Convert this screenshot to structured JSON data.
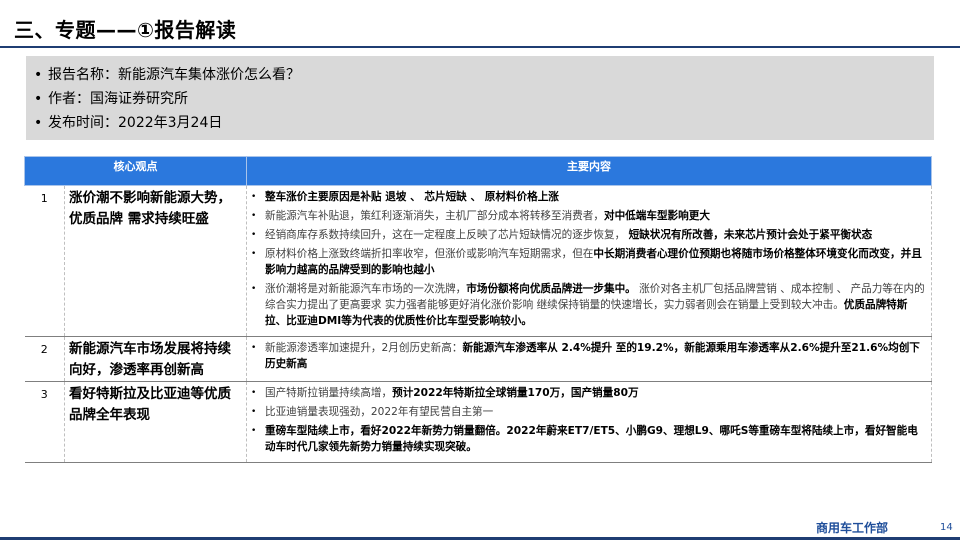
{
  "header": {
    "title": "三、专题——①报告解读"
  },
  "info": [
    "报告名称：新能源汽车集体涨价怎么看？",
    "作者：国海证券研究所",
    "发布时间：2022年3月24日"
  ],
  "table": {
    "headers": [
      "核心观点",
      "主要内容"
    ],
    "rows": [
      {
        "num": "1",
        "point": "涨价潮不影响新能源大势，优质品牌 需求持续旺盛",
        "bullets": [
          {
            "plain": "",
            "bold": "整车涨价主要原因是补贴 退坡 、 芯片短缺 、 原材料价格上涨",
            "tail": ""
          },
          {
            "plain": "新能源汽车补贴退，策红利逐渐消失，主机厂部分成本将转移至消费者，",
            "bold": "对中低端车型影响更大",
            "tail": ""
          },
          {
            "plain": "经销商库存系数持续回升，这在一定程度上反映了芯片短缺情况的逐步恢复， ",
            "bold": "短缺状况有所改善，未来芯片预计会处于紧平衡状态",
            "tail": ""
          },
          {
            "plain": "原材料价格上涨致终端折扣率收窄，但涨价或影响汽车短期需求，但在",
            "bold": "中长期消费者心理价位预期也将随市场价格整体环境变化而改变，并且影响力越高的品牌受到的影响也越小",
            "tail": ""
          },
          {
            "plain": "涨价潮将是对新能源汽车市场的一次洗牌，",
            "bold": "市场份额将向优质品牌进一步集中。",
            "tail": " 涨价对各主机厂包括品牌营销 、成本控制 、 产品力等在内的综合实力提出了更高要求 实力强者能够更好消化涨价影响 继续保持销量的快速增长，实力弱者则会在销量上受到较大冲击。",
            "tail_bold": "优质品牌特斯拉、比亚迪DMI等为代表的优质性价比车型受影响较小。"
          }
        ]
      },
      {
        "num": "2",
        "point": "新能源汽车市场发展将持续向好，渗透率再创新高",
        "bullets": [
          {
            "plain": "新能源渗透率加速提升，2月创历史新高：",
            "bold": "新能源汽车渗透率从 2.4%提升 至的19.2%，新能源乘用车渗透率从2.6%提升至21.6%均创下历史新高",
            "tail": ""
          }
        ]
      },
      {
        "num": "3",
        "point": "看好特斯拉及比亚迪等优质品牌全年表现",
        "bullets": [
          {
            "plain": "国产特斯拉销量持续高增，",
            "bold": "预计2022年特斯拉全球销量170万，国产销量80万",
            "tail": ""
          },
          {
            "plain": "比亚迪销量表现强劲，2022年有望民营自主第一",
            "bold": "",
            "tail": ""
          },
          {
            "plain": "",
            "bold": "重磅车型陆续上市，看好2022年新势力销量翻倍。2022年蔚来ET7/ET5、小鹏G9、理想L9、哪吒S等重磅车型将陆续上市，看好智能电动车时代几家领先新势力销量持续实现突破。",
            "tail": ""
          }
        ]
      }
    ]
  },
  "footer": {
    "department": "商用车工作部",
    "page": "14"
  }
}
